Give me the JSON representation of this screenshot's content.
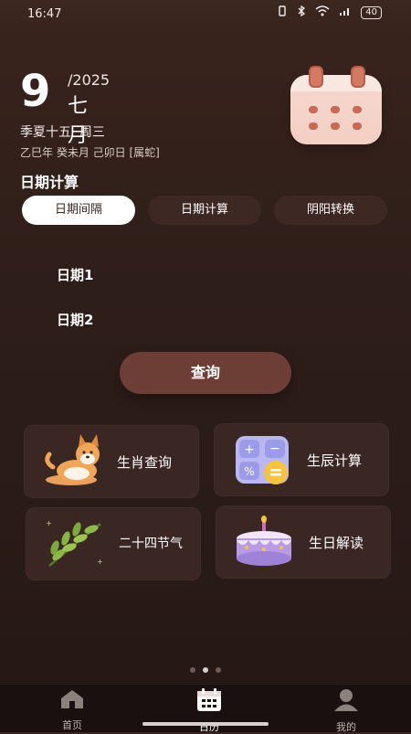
{
  "status_bar": {
    "time": "16:47",
    "battery": "40"
  },
  "header": {
    "day": "9",
    "year": "/2025",
    "month": "七月",
    "lunar_date": "季夏十五",
    "weekday": "周三",
    "ganzhi": "乙巳年 癸未月 己卯日 [属蛇]"
  },
  "section": {
    "title": "日期计算"
  },
  "tabs": [
    {
      "label": "日期间隔",
      "active": true
    },
    {
      "label": "日期计算",
      "active": false
    },
    {
      "label": "阴阳转换",
      "active": false
    }
  ],
  "fields": {
    "date1_label": "日期1",
    "date2_label": "日期2"
  },
  "query_button": {
    "label": "查询"
  },
  "feature_cards": [
    {
      "label": "生肖查询",
      "icon": "corgi-dog-icon"
    },
    {
      "label": "生辰计算",
      "icon": "calculator-icon"
    },
    {
      "label": "二十四节气",
      "icon": "leaf-branch-icon"
    },
    {
      "label": "生日解读",
      "icon": "birthday-cake-icon"
    }
  ],
  "pager": {
    "count": 3,
    "active_index": 1
  },
  "bottom_nav": [
    {
      "label": "首页",
      "icon": "home-icon",
      "active": false
    },
    {
      "label": "日历",
      "icon": "calendar-icon",
      "active": true
    },
    {
      "label": "我的",
      "icon": "user-icon",
      "active": false
    }
  ],
  "colors": {
    "background": "#2f1e19",
    "card": "#3a2622",
    "accent_button": "#6d3e36",
    "tab_inactive": "#3d2823",
    "tab_active": "#ffffff"
  }
}
